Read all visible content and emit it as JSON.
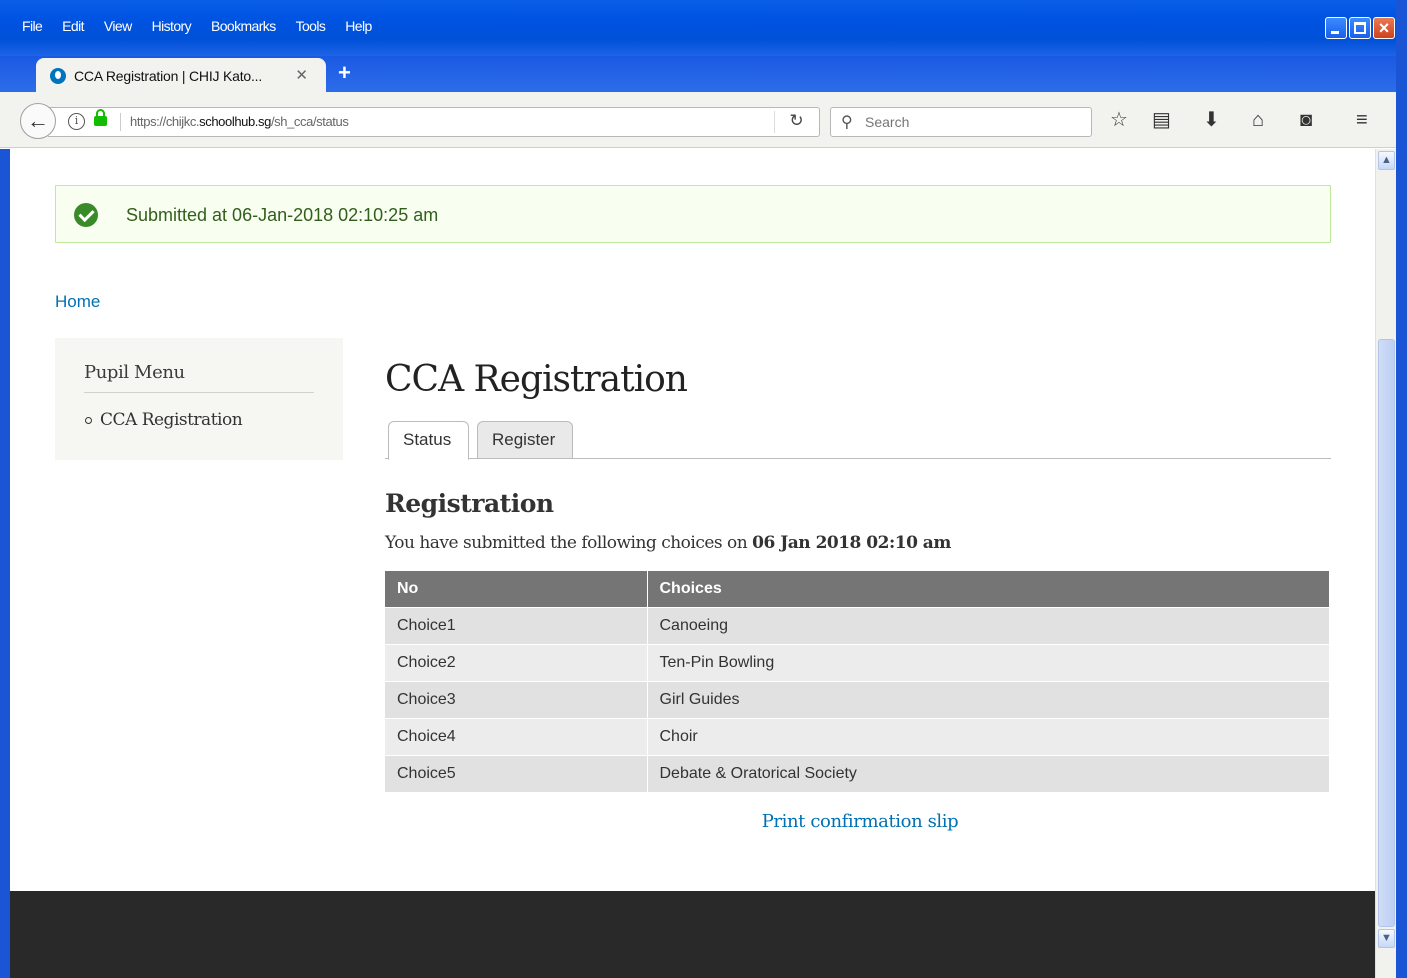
{
  "browser": {
    "menu": [
      "File",
      "Edit",
      "View",
      "History",
      "Bookmarks",
      "Tools",
      "Help"
    ],
    "tab_title": "CCA Registration | CHIJ Kato...",
    "tab_close": "✕",
    "new_tab": "+",
    "url_prefix": "https://chijkc.",
    "url_domain": "schoolhub.sg",
    "url_path": "/sh_cca/status",
    "search_placeholder": "Search",
    "toolbar_icons": [
      "bookmark-star-icon",
      "reading-list-icon",
      "downloads-icon",
      "home-icon",
      "pocket-icon",
      "menu-icon"
    ]
  },
  "status": {
    "message": "Submitted at 06-Jan-2018 02:10:25 am",
    "color": "#3b8a2a"
  },
  "breadcrumb": {
    "home": "Home"
  },
  "sidebar": {
    "title": "Pupil Menu",
    "items": [
      {
        "label": "CCA Registration"
      }
    ]
  },
  "main": {
    "title": "CCA Registration",
    "tabs": [
      {
        "label": "Status",
        "active": true
      },
      {
        "label": "Register",
        "active": false
      }
    ],
    "section_title": "Registration",
    "submitted_prefix": "You have submitted the following choices on ",
    "submitted_date": "06 Jan 2018 02:10 am",
    "table": {
      "headers": [
        "No",
        "Choices"
      ],
      "rows": [
        [
          "Choice1",
          "Canoeing"
        ],
        [
          "Choice2",
          "Ten-Pin Bowling"
        ],
        [
          "Choice3",
          "Girl Guides"
        ],
        [
          "Choice4",
          "Choir"
        ],
        [
          "Choice5",
          "Debate & Oratorical Society"
        ]
      ]
    },
    "print_link": "Print confirmation slip"
  },
  "colors": {
    "link": "#0071b3",
    "table_header": "#757575",
    "footer": "#292929",
    "titlebar": "#0054e3"
  }
}
